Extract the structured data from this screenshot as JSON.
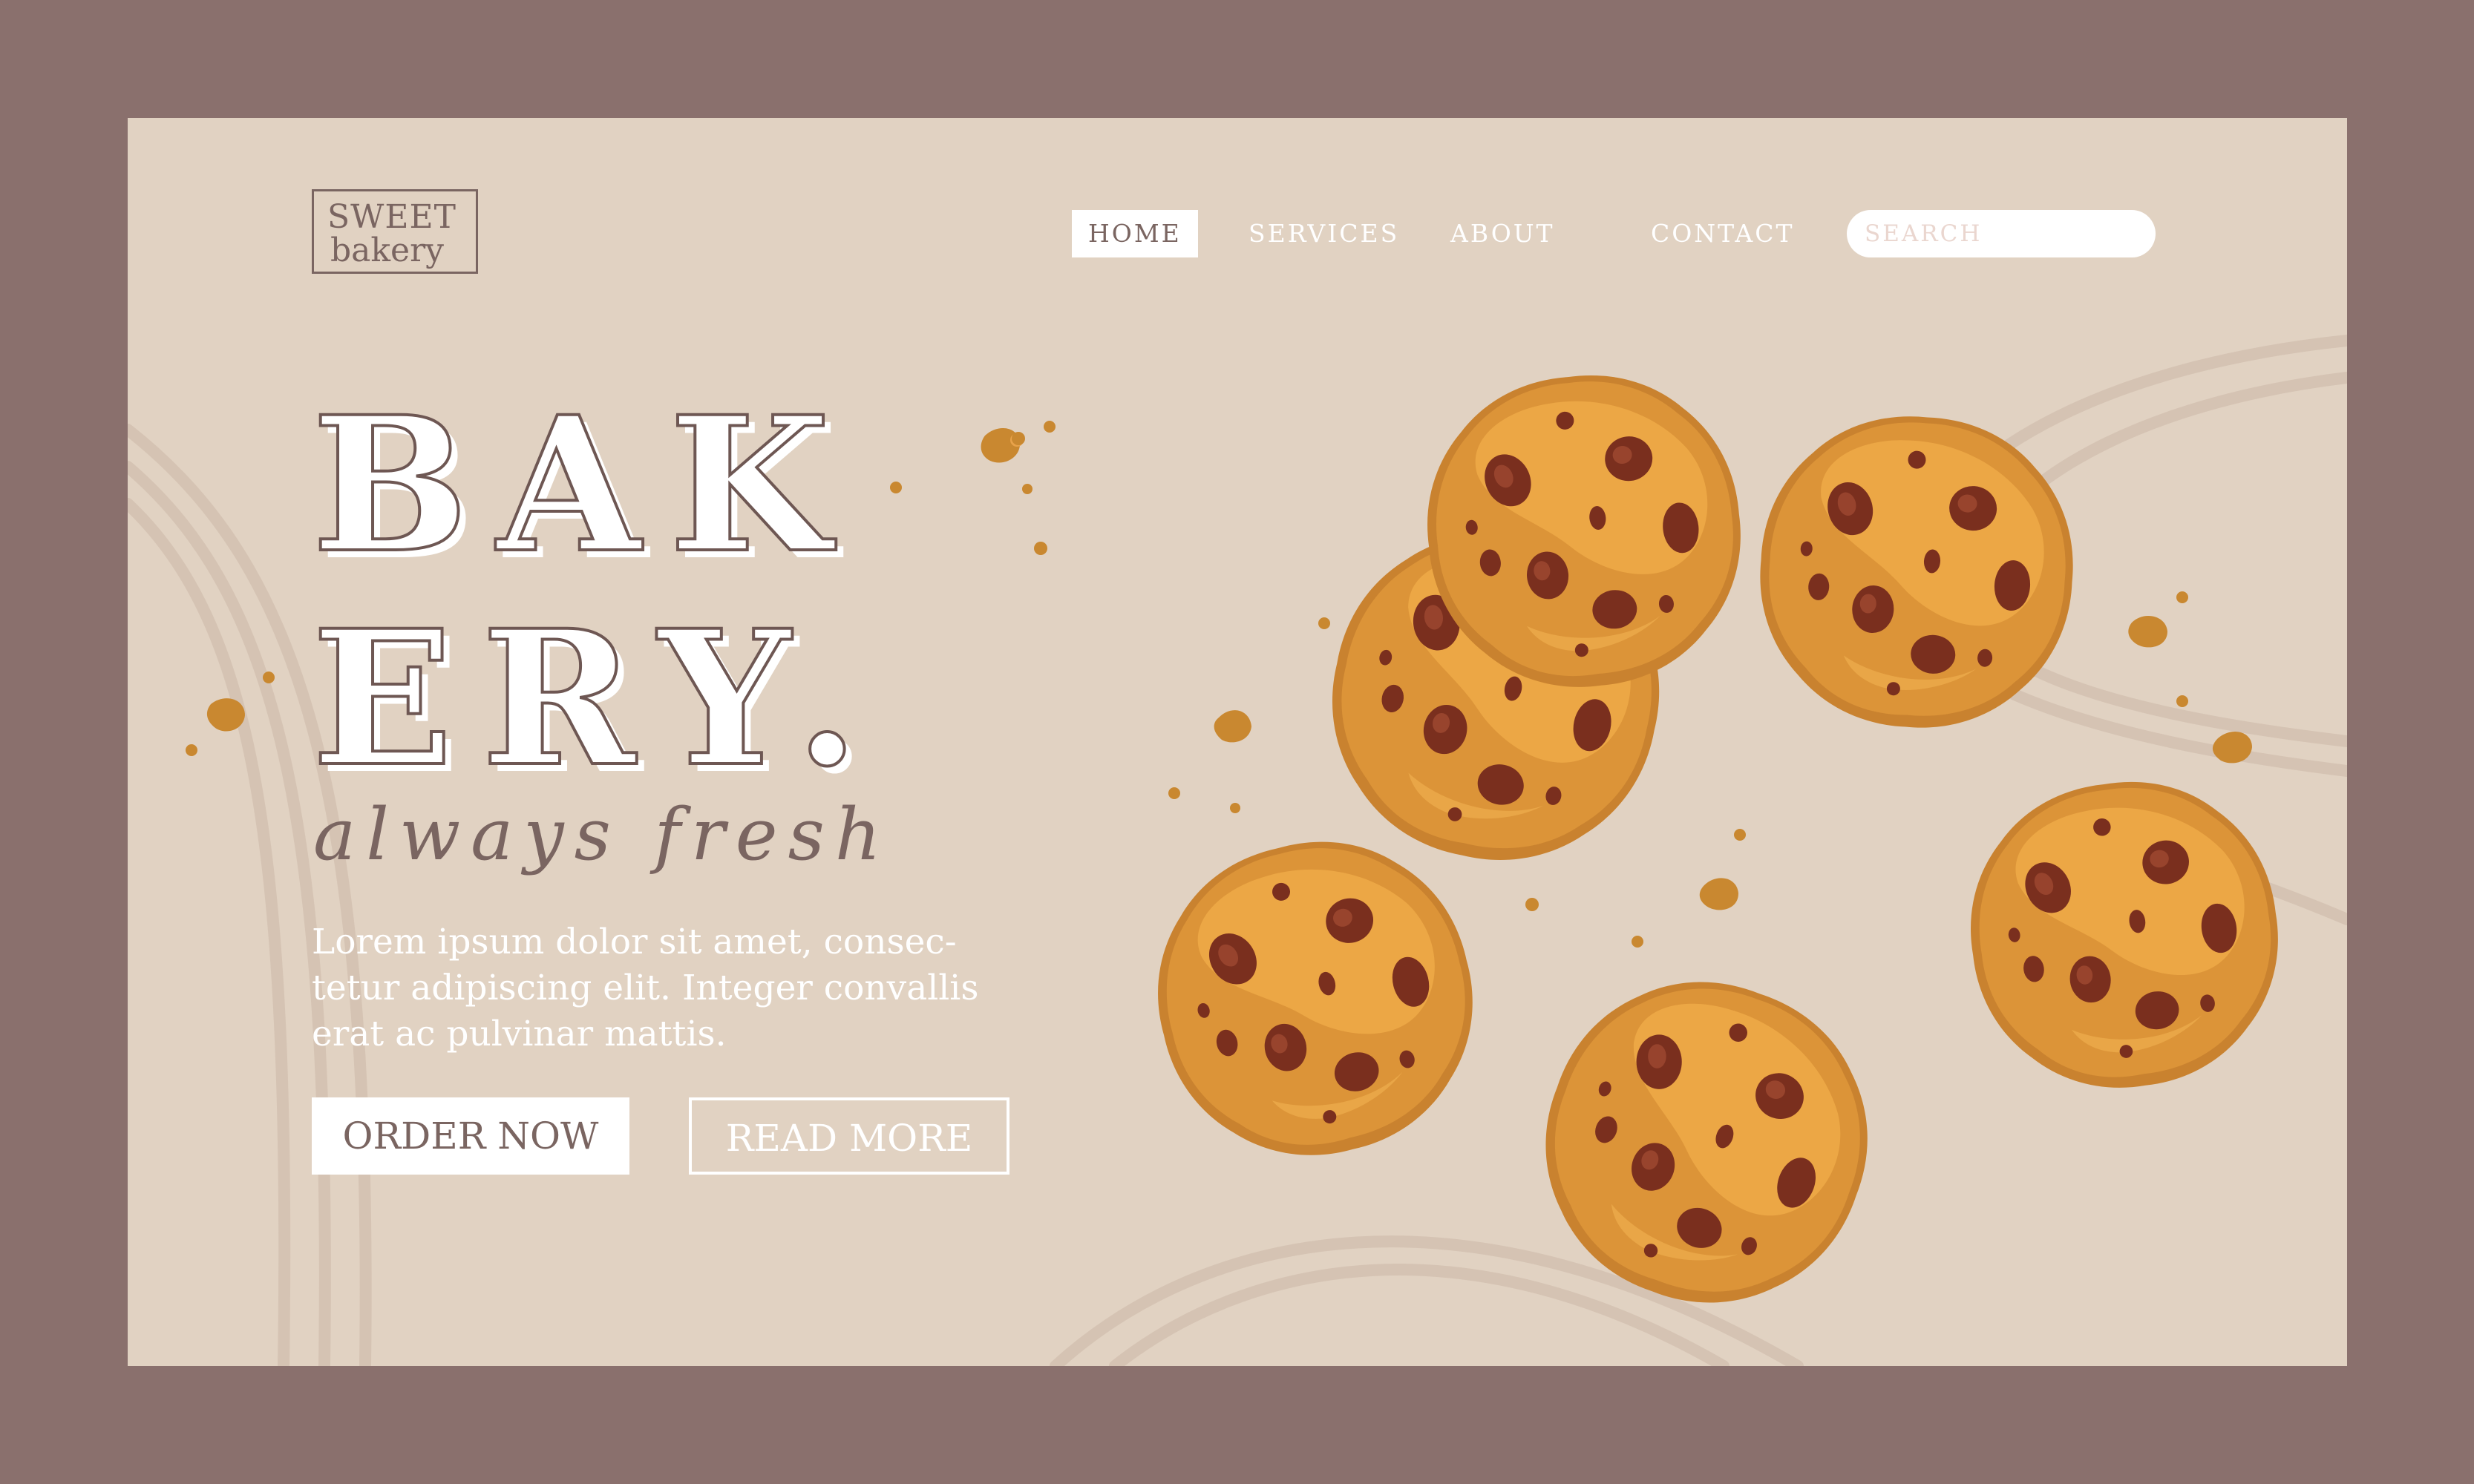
{
  "brand": {
    "line1": "SWEET",
    "line2": "bakery"
  },
  "nav": {
    "items": [
      "HOME",
      "SERVICES",
      "ABOUT",
      "CONTACT"
    ],
    "search_placeholder": "SEARCH"
  },
  "hero": {
    "title_line1": "BAK",
    "title_line2": "ERY.",
    "tagline": "always fresh",
    "description": "Lorem ipsum dolor sit amet, consec-tetur adipiscing elit. Integer convallis erat ac pulvinar mattis.",
    "order_label": "ORDER NOW",
    "read_more_label": "READ MORE"
  },
  "colors": {
    "frame": "#8a706d",
    "page_bg": "#e1d2c2",
    "text_brown": "#7a6561",
    "cookie": "#e8a24a",
    "chocolate": "#7a2f1e"
  },
  "icons": [
    "cookie-icon",
    "crumb-icon"
  ]
}
